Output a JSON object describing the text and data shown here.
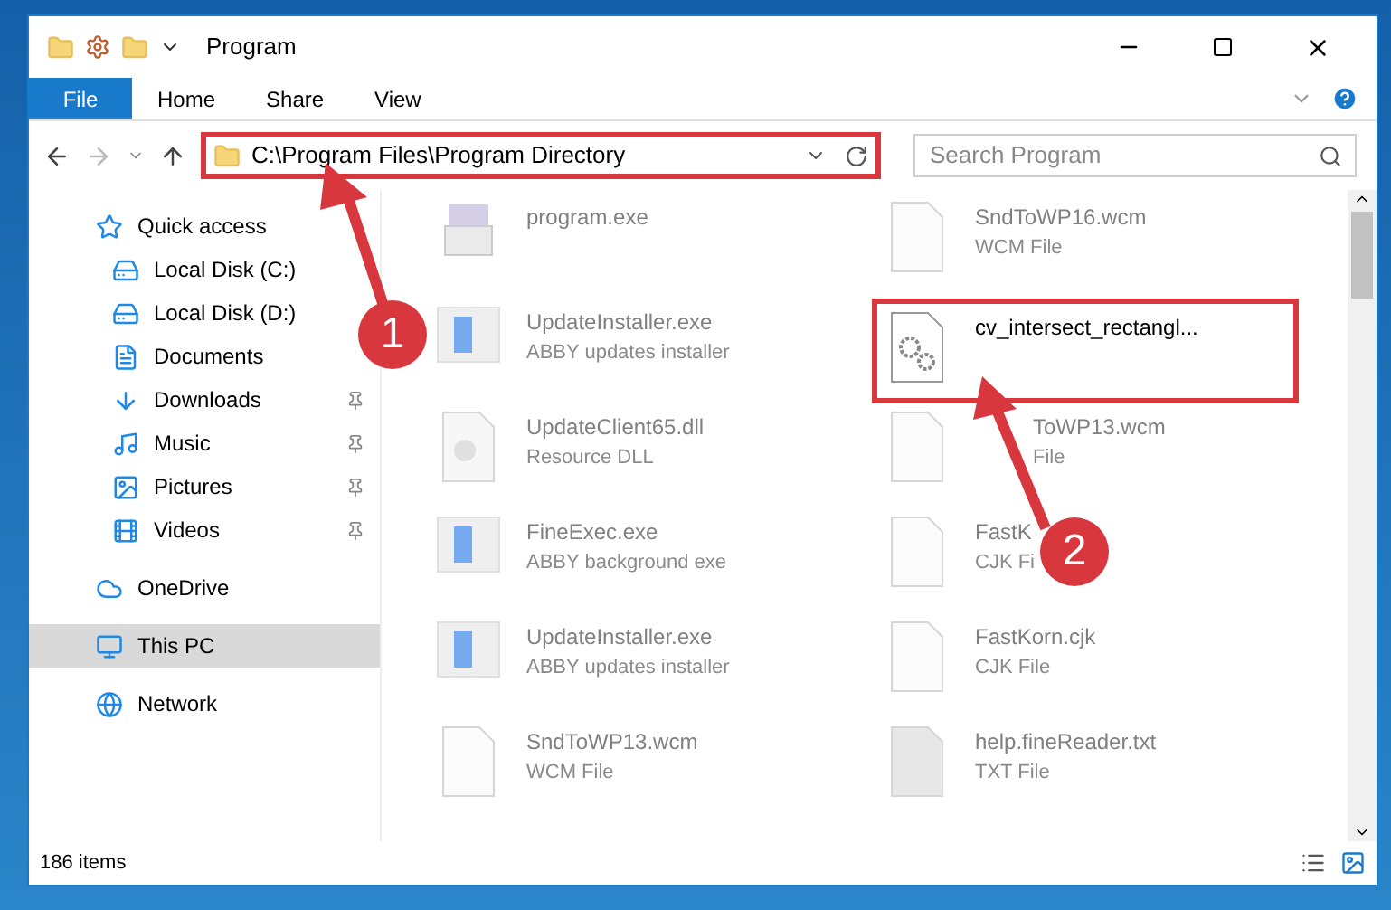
{
  "window": {
    "title": "Program"
  },
  "ribbon": {
    "tabs": [
      {
        "label": "File",
        "selected": true
      },
      {
        "label": "Home",
        "selected": false
      },
      {
        "label": "Share",
        "selected": false
      },
      {
        "label": "View",
        "selected": false
      }
    ]
  },
  "address_bar": {
    "path": "C:\\Program Files\\Program Directory",
    "highlighted": true
  },
  "search": {
    "placeholder": "Search Program"
  },
  "sidebar": {
    "items": [
      {
        "label": "Quick access",
        "selected": false,
        "children": [
          {
            "label": "Local Disk (C:)",
            "pinned": false,
            "selected": false
          },
          {
            "label": "Local Disk (D:)",
            "pinned": false,
            "selected": false
          },
          {
            "label": "Documents",
            "pinned": false,
            "selected": false
          },
          {
            "label": "Downloads",
            "pinned": true,
            "selected": false
          },
          {
            "label": "Music",
            "pinned": true,
            "selected": false
          },
          {
            "label": "Pictures",
            "pinned": true,
            "selected": false
          },
          {
            "label": "Videos",
            "pinned": true,
            "selected": false
          }
        ]
      },
      {
        "label": "OneDrive",
        "selected": false
      },
      {
        "label": "This PC",
        "selected": true
      },
      {
        "label": "Network",
        "selected": false
      }
    ]
  },
  "files": [
    {
      "name": "program.exe",
      "kind": "installer",
      "faded": true,
      "highlighted": false
    },
    {
      "name": "SndToWP16.wcm",
      "type": "WCM File",
      "kind": "blank",
      "faded": true,
      "highlighted": false
    },
    {
      "name": "UpdateInstaller.exe",
      "type": "ABBY updates installer",
      "kind": "app",
      "faded": true,
      "highlighted": false
    },
    {
      "name": "cv_intersect_rectangl...",
      "kind": "gear",
      "faded": false,
      "highlighted": true
    },
    {
      "name": "UpdateClient65.dll",
      "type": "Resource DLL",
      "kind": "dll",
      "faded": true,
      "highlighted": false
    },
    {
      "name": "ToWP13.wcm",
      "type": "File",
      "kind": "covered",
      "faded": true,
      "highlighted": false
    },
    {
      "name": "FineExec.exe",
      "type": "ABBY background exe",
      "kind": "app",
      "faded": true,
      "highlighted": false
    },
    {
      "name": "FastK",
      "type": "CJK Fi",
      "kind": "blank",
      "faded": true,
      "highlighted": false
    },
    {
      "name": "UpdateInstaller.exe",
      "type": "ABBY updates installer",
      "kind": "app",
      "faded": true,
      "highlighted": false
    },
    {
      "name": "FastKorn.cjk",
      "type": "CJK File",
      "kind": "blank",
      "faded": true,
      "highlighted": false
    },
    {
      "name": "SndToWP13.wcm",
      "type": "WCM File",
      "kind": "blank",
      "faded": true,
      "highlighted": false
    },
    {
      "name": "help.fineReader.txt",
      "type": "TXT File",
      "kind": "txt",
      "faded": true,
      "highlighted": false
    }
  ],
  "status_bar": {
    "count": "186 items"
  },
  "annotations": [
    {
      "label": "1"
    },
    {
      "label": "2"
    }
  ]
}
